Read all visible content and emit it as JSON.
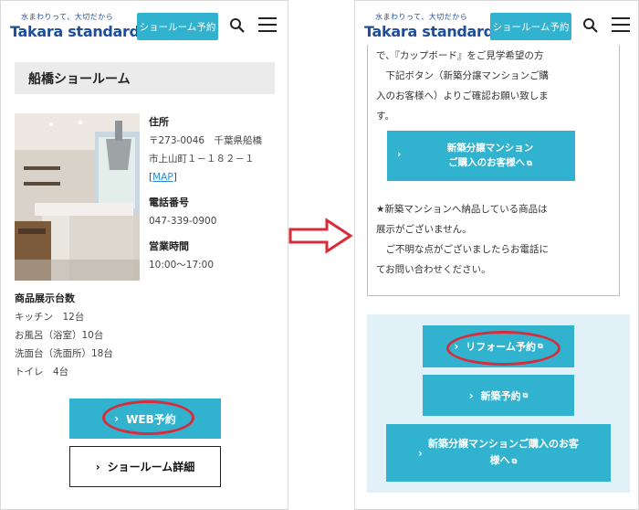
{
  "header": {
    "tagline": "水まわりって、大切だから",
    "brand": "Takara standard",
    "reserve_label": "ショールーム予約"
  },
  "left": {
    "store_name": "船橋ショールーム",
    "address_label": "住所",
    "address_line1": "〒273-0046　千葉県船橋",
    "address_line2": "市上山町１－１８２－１",
    "map_link": "MAP",
    "phone_label": "電話番号",
    "phone": "047-339-0900",
    "hours_label": "営業時間",
    "hours": "10:00～17:00",
    "exhibit_title": "商品展示台数",
    "exhibit_items": [
      "キッチン　12台",
      "お風呂（浴室）10台",
      "洗面台（洗面所）18台",
      "トイレ　4台"
    ],
    "web_reserve_label": "WEB予約",
    "detail_label": "ショールーム詳細"
  },
  "right": {
    "para1": [
      "で、『カップボード』をご見学希望の方",
      "　下記ボタン（新築分譲マンションご購",
      "入のお客様へ）よりご確認お願い致しま",
      "す。"
    ],
    "new_buyer_btn": [
      "新築分譲マンション",
      "ご購入のお客様へ"
    ],
    "para2": [
      "★新築マンションへ納品している商品は",
      "展示がございません。",
      "　ご不明な点がございましたらお電話に",
      "てお問い合わせください。"
    ],
    "reform_label": "リフォーム予約",
    "newbuild_label": "新築予約",
    "condo_label": [
      "新築分譲マンションご購入のお客",
      "様へ"
    ]
  },
  "colors": {
    "accent": "#31b2cf",
    "brand": "#1e4e9a",
    "highlight": "#d92b3a",
    "section_bg": "#e1f1f7"
  },
  "icons": [
    "search-icon",
    "menu-icon",
    "chevron-right-icon",
    "external-link-icon",
    "right-arrow-icon"
  ]
}
